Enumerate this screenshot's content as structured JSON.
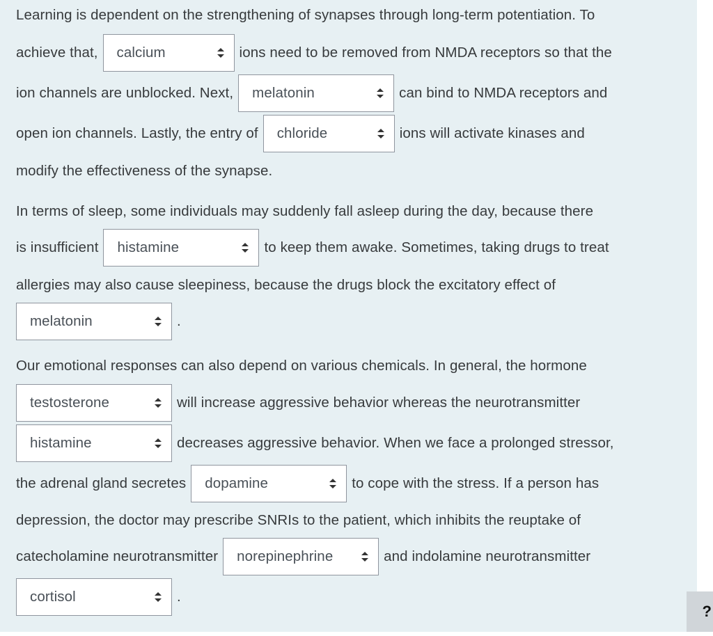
{
  "paragraphs": [
    {
      "segments": {
        "t1": "Learning is dependent on the strengthening of synapses through long-term potentiation. To",
        "t2": "achieve that,",
        "s1": "calcium",
        "t3": "ions need to be removed from NMDA receptors so that the",
        "t4": "ion channels are unblocked. Next,",
        "s2": "melatonin",
        "t5": "can bind to NMDA receptors and",
        "t6": "open ion channels. Lastly, the entry of",
        "s3": "chloride",
        "t7": "ions will activate kinases and",
        "t8": "modify the effectiveness of the synapse."
      }
    },
    {
      "segments": {
        "t1": "In terms of sleep, some individuals may suddenly fall asleep during the day, because there",
        "t2": "is insufficient",
        "s1": "histamine",
        "t3": "to keep them awake. Sometimes, taking drugs to treat",
        "t4": "allergies may also cause sleepiness, because the drugs block the excitatory effect of",
        "s2": "melatonin",
        "t5": "."
      }
    },
    {
      "segments": {
        "t1": "Our emotional responses can also depend on various chemicals. In general, the hormone",
        "s1": "testosterone",
        "t2": "will increase aggressive behavior whereas the neurotransmitter",
        "s2": "histamine",
        "t3": "decreases aggressive behavior. When we face a prolonged stressor,",
        "t4": "the adrenal gland secretes",
        "s3": "dopamine",
        "t5": "to cope with the stress. If a person has",
        "t6": "depression, the doctor may prescribe SNRIs to the patient, which inhibits the reuptake of",
        "t7": "catecholamine neurotransmitter",
        "s4": "norepinephrine",
        "t8": "and indolamine neurotransmitter",
        "s5": "cortisol",
        "t9": "."
      }
    }
  ],
  "help_button": {
    "label": "?"
  },
  "colors": {
    "panel_bg": "#e7f0f3",
    "select_border": "#8f959e",
    "text": "#373a3c",
    "help_bg": "#d0d5d9"
  }
}
